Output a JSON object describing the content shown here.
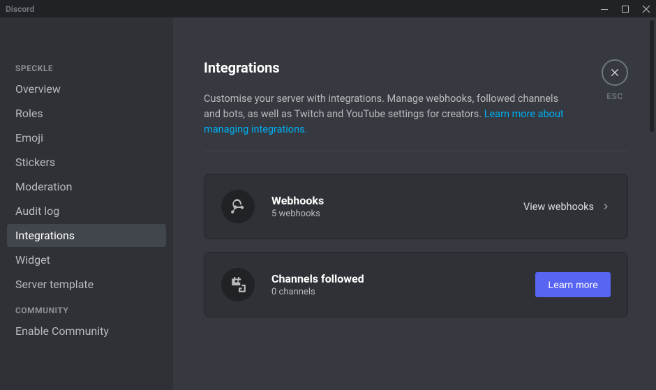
{
  "app": {
    "title": "Discord"
  },
  "sidebar": {
    "section1_header": "SPECKLE",
    "section2_header": "COMMUNITY",
    "items": [
      {
        "label": "Overview"
      },
      {
        "label": "Roles"
      },
      {
        "label": "Emoji"
      },
      {
        "label": "Stickers"
      },
      {
        "label": "Moderation"
      },
      {
        "label": "Audit log"
      },
      {
        "label": "Integrations"
      },
      {
        "label": "Widget"
      },
      {
        "label": "Server template"
      }
    ],
    "community_items": [
      {
        "label": "Enable Community"
      }
    ]
  },
  "page": {
    "title": "Integrations",
    "description_pre": "Customise your server with integrations. Manage webhooks, followed channels and bots, as well as Twitch and YouTube settings for creators. ",
    "description_link": "Learn more about managing integrations."
  },
  "cards": {
    "webhooks": {
      "title": "Webhooks",
      "subtitle": "5 webhooks",
      "action": "View webhooks"
    },
    "channels": {
      "title": "Channels followed",
      "subtitle": "0 channels",
      "action": "Learn more"
    }
  },
  "close": {
    "label": "ESC"
  }
}
